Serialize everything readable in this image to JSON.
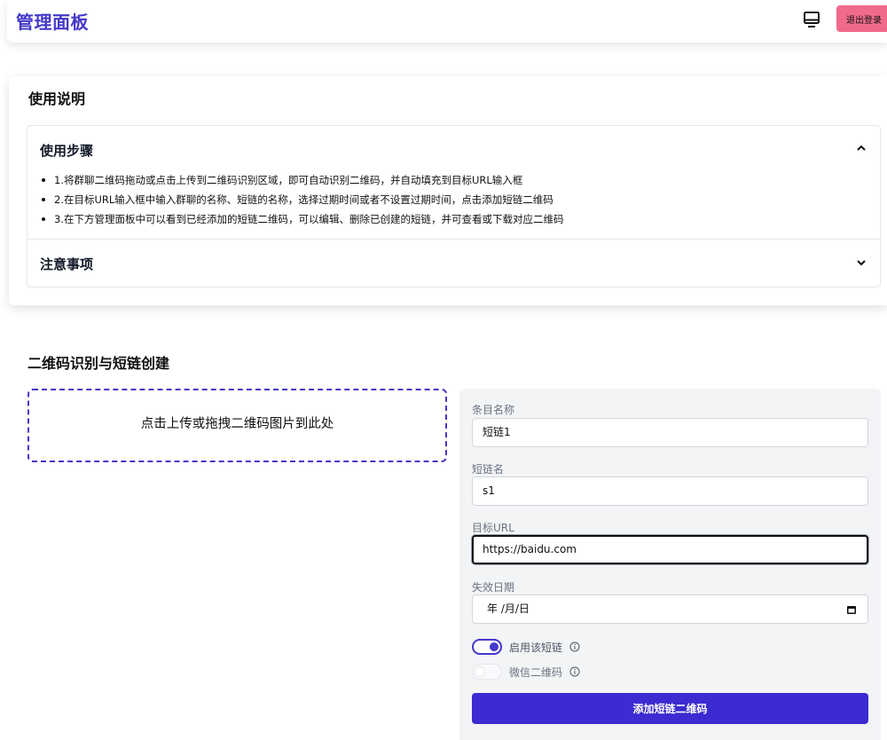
{
  "header": {
    "title": "管理面板",
    "logout_label": "退出登录",
    "icons": {
      "display_toggle": "monitor-icon"
    }
  },
  "instructions": {
    "title": "使用说明",
    "sections": [
      {
        "heading": "使用步骤",
        "expanded": true,
        "steps": [
          "1.将群聊二维码拖动或点击上传到二维码识别区域，即可自动识别二维码，并自动填充到目标URL输入框",
          "2.在目标URL输入框中输入群聊的名称、短链的名称，选择过期时间或者不设置过期时间，点击添加短链二维码",
          "3.在下方管理面板中可以看到已经添加的短链二维码，可以编辑、删除已创建的短链，并可查看或下载对应二维码"
        ]
      },
      {
        "heading": "注意事项",
        "expanded": false
      }
    ]
  },
  "qr_section": {
    "title": "二维码识别与短链创建",
    "dropzone_text": "点击上传或拖拽二维码图片到此处"
  },
  "form": {
    "item_name_label": "条目名称",
    "item_name_value": "短链1",
    "short_name_label": "短链名",
    "short_name_value": "s1",
    "target_url_label": "目标URL",
    "target_url_value": "https://baidu.com",
    "expiry_label": "失效日期",
    "expiry_placeholder": "年 /月/日",
    "enable_label": "启用该短链",
    "enable_on": true,
    "wechat_label": "微信二维码",
    "wechat_on": false,
    "submit_label": "添加短链二维码"
  },
  "colors": {
    "accent": "#4338ca",
    "logout": "#f06b8a",
    "submit": "#3b2bd0"
  }
}
